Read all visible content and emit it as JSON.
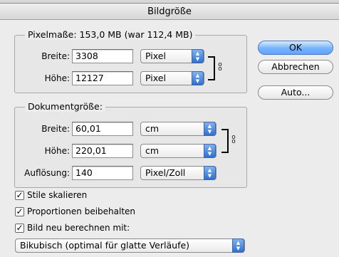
{
  "dialog": {
    "title": "Bildgröße"
  },
  "pixel_dimensions": {
    "legend": "Pixelmaße: 153,0 MB (war 112,4 MB)",
    "width_label": "Breite:",
    "width_value": "3308",
    "width_unit": "Pixel",
    "height_label": "Höhe:",
    "height_value": "12127",
    "height_unit": "Pixel"
  },
  "document_size": {
    "legend": "Dokumentgröße:",
    "width_label": "Breite:",
    "width_value": "60,01",
    "width_unit": "cm",
    "height_label": "Höhe:",
    "height_value": "220,01",
    "height_unit": "cm",
    "resolution_label": "Auflösung:",
    "resolution_value": "140",
    "resolution_unit": "Pixel/Zoll"
  },
  "buttons": {
    "ok": "OK",
    "cancel": "Abbrechen",
    "auto": "Auto..."
  },
  "options": {
    "scale_styles": {
      "label": "Stile skalieren",
      "checked": true
    },
    "constrain_proportions": {
      "label": "Proportionen beibehalten",
      "checked": true
    },
    "resample": {
      "label": "Bild neu berechnen mit:",
      "checked": true
    }
  },
  "resample_method": {
    "value": "Bikubisch (optimal für glatte Verläufe)"
  },
  "icons": {
    "link": "link-icon",
    "popup": "updown-arrows-icon",
    "check": "checkmark-icon"
  }
}
